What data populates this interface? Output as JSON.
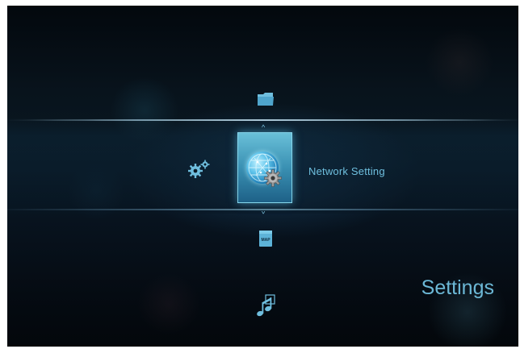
{
  "menu": {
    "selected_item_label": "Network Setting",
    "section_title": "Settings",
    "items": [
      {
        "icon": "folder-icon"
      },
      {
        "icon": "settings-gears-icon"
      },
      {
        "icon": "network-globe-gear-icon",
        "selected": true
      },
      {
        "icon": "map-file-icon",
        "label": "MAP"
      },
      {
        "icon": "music-notes-icon"
      }
    ]
  },
  "colors": {
    "accent": "#6fc0df",
    "selector": "#4aa8cf",
    "background": "#07111a"
  }
}
